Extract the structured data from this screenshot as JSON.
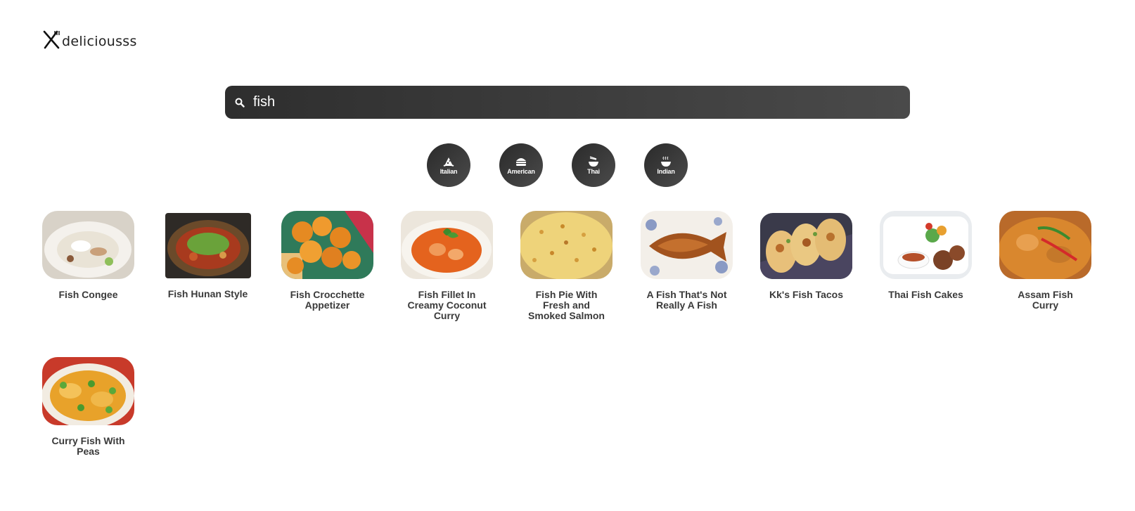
{
  "brand": {
    "name": "deliciousss"
  },
  "search": {
    "value": "fish"
  },
  "cuisines": [
    {
      "label": "Italian",
      "icon": "pizza-icon"
    },
    {
      "label": "American",
      "icon": "burger-icon"
    },
    {
      "label": "Thai",
      "icon": "noodle-bowl-icon"
    },
    {
      "label": "Indian",
      "icon": "curry-bowl-icon"
    }
  ],
  "recipes": [
    {
      "title": "Fish Congee"
    },
    {
      "title": "Fish Hunan Style"
    },
    {
      "title": "Fish Crocchette Appetizer"
    },
    {
      "title": "Fish Fillet In Creamy Coconut Curry"
    },
    {
      "title": "Fish Pie With Fresh and Smoked Salmon"
    },
    {
      "title": "A Fish That's Not Really A Fish"
    },
    {
      "title": "Kk's Fish Tacos"
    },
    {
      "title": "Thai Fish Cakes"
    },
    {
      "title": "Assam Fish Curry"
    },
    {
      "title": "Curry Fish With Peas"
    }
  ]
}
